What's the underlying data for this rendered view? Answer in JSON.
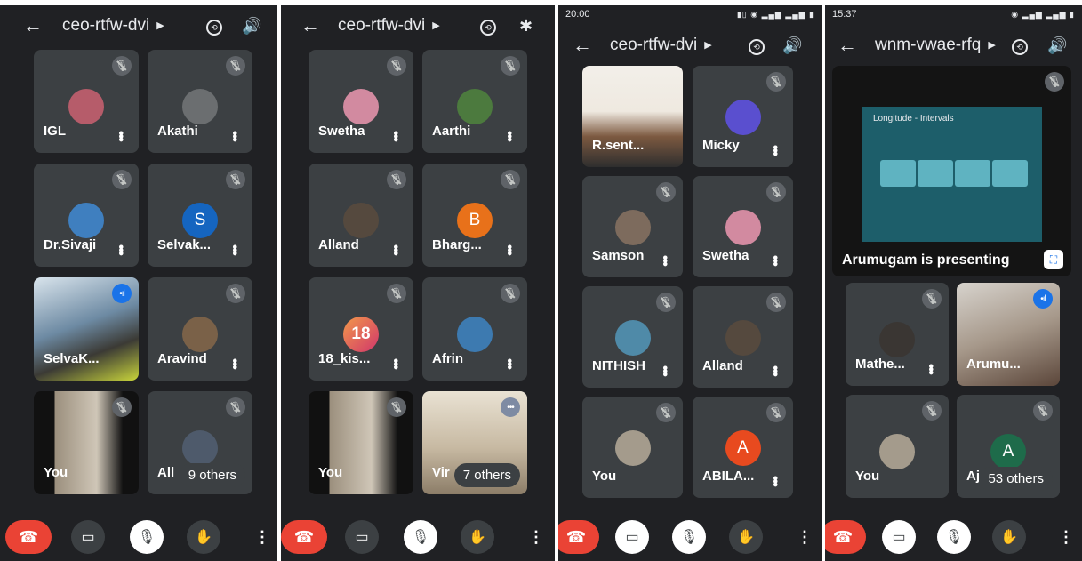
{
  "panels": [
    {
      "meeting_title": "ceo-rtfw-dvi",
      "tiles": [
        {
          "name": "IGL"
        },
        {
          "name": "Akathi"
        },
        {
          "name": "Dr.Sivaji"
        },
        {
          "name": "Selvak...",
          "initial": "S"
        },
        {
          "name": "SelvaK..."
        },
        {
          "name": "Aravind"
        },
        {
          "name": "You"
        },
        {
          "name": "All"
        }
      ],
      "others": "9 others"
    },
    {
      "meeting_title": "ceo-rtfw-dvi",
      "tiles": [
        {
          "name": "Swetha"
        },
        {
          "name": "Aarthi"
        },
        {
          "name": "Alland"
        },
        {
          "name": "Bharg...",
          "initial": "B"
        },
        {
          "name": "18_kis..."
        },
        {
          "name": "Afrin"
        },
        {
          "name": "You"
        },
        {
          "name": "Vir"
        }
      ],
      "others": "7 others",
      "avatar_18_text": "18"
    },
    {
      "status_time": "20:00",
      "meeting_title": "ceo-rtfw-dvi",
      "tiles": [
        {
          "name": "R.sent..."
        },
        {
          "name": "Micky"
        },
        {
          "name": "Samson"
        },
        {
          "name": "Swetha"
        },
        {
          "name": "NITHISH"
        },
        {
          "name": "Alland"
        },
        {
          "name": "You"
        },
        {
          "name": "ABILA...",
          "initial": "A"
        }
      ]
    },
    {
      "status_time": "15:37",
      "meeting_title": "wnm-vwae-rfq",
      "presentation": {
        "slide_title": "Longitude - Intervals",
        "caption": "Arumugam is presenting"
      },
      "tiles": [
        {
          "name": "Mathe..."
        },
        {
          "name": "Arumu..."
        },
        {
          "name": "You"
        },
        {
          "name": "Aj",
          "initial": "A"
        }
      ],
      "others": "53 others"
    }
  ],
  "colors": {
    "background": "#202124",
    "tile": "#3c4043",
    "end_call": "#ea4335",
    "speaking": "#1a73e8"
  },
  "icons": {
    "back": "back-arrow-icon",
    "switch_camera": "switch-camera-icon",
    "speaker": "speaker-icon",
    "bluetooth": "bluetooth-icon",
    "end_call": "end-call-icon",
    "camera": "camera-icon",
    "mic_off": "mic-off-icon",
    "raise_hand": "raise-hand-icon",
    "more": "more-vert-icon"
  }
}
